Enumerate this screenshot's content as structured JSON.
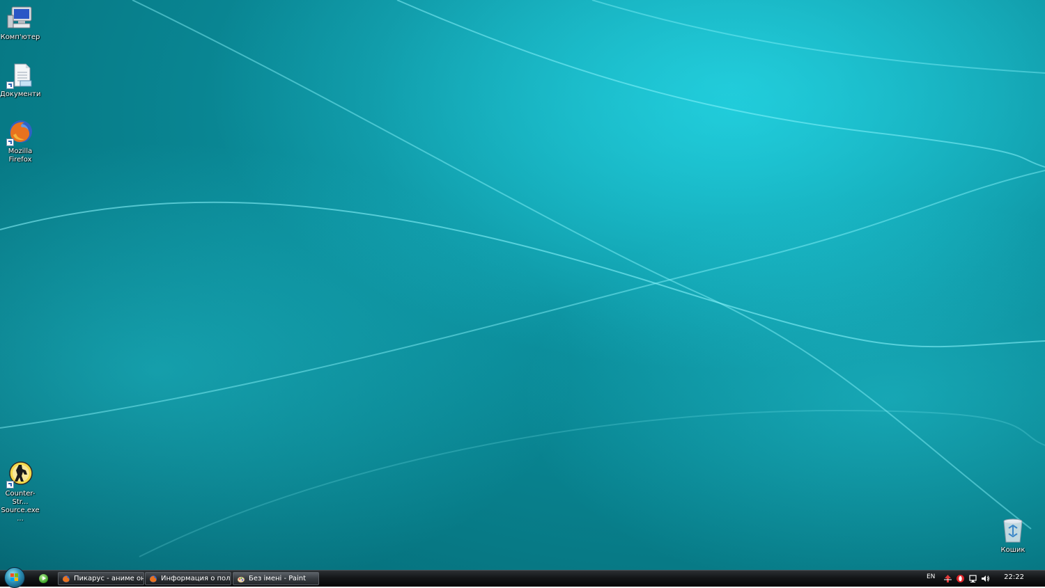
{
  "desktop": {
    "icons": [
      {
        "label": "Комп'ютер",
        "icon": "computer-icon"
      },
      {
        "label": "Документи",
        "icon": "documents-icon"
      },
      {
        "label": "Mozilla\nFirefox",
        "icon": "firefox-icon"
      },
      {
        "label": "Counter-Str...\nSource.exe ...",
        "icon": "counter-strike-icon"
      },
      {
        "label": "Кошик",
        "icon": "recycle-bin-icon"
      }
    ]
  },
  "taskbar": {
    "start_icon": "windows-start-orb-icon",
    "quicklaunch": [
      {
        "icon": "media-play-icon"
      }
    ],
    "tasks": [
      {
        "label": "Пикарус - аниме он...",
        "icon": "firefox-icon"
      },
      {
        "label": "Информация о пол...",
        "icon": "firefox-icon"
      },
      {
        "label": "Без імені - Paint",
        "icon": "paint-icon"
      }
    ],
    "tray": {
      "language": "EN",
      "icons": [
        "network-arrows-icon",
        "opera-icon",
        "network-monitor-icon",
        "volume-icon"
      ],
      "clock": "22:22"
    }
  },
  "colors": {
    "wallpaper_base": "#0b8f9d",
    "wallpaper_highlight": "#21d6e6",
    "taskbar": "#141618"
  }
}
